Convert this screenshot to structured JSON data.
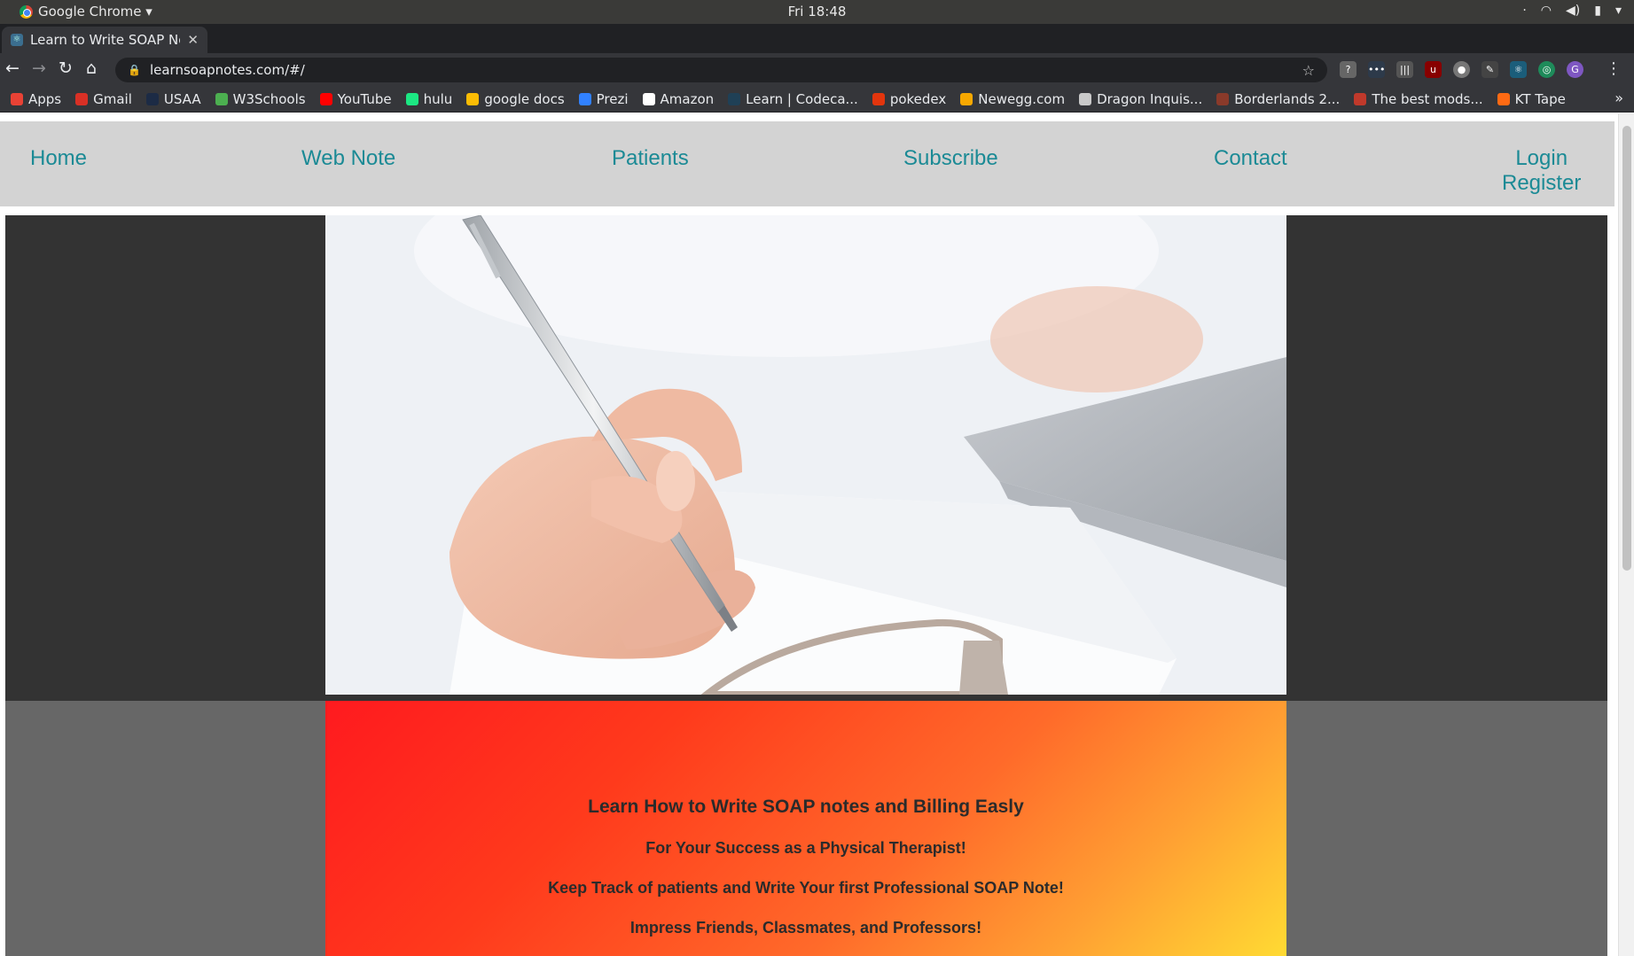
{
  "os": {
    "app_name": "Google Chrome ▾",
    "clock": "Fri 18:48"
  },
  "browser": {
    "tab_title": "Learn to Write SOAP Note",
    "url": "learnsoapnotes.com/#/",
    "bookmarks": [
      {
        "label": "Apps",
        "color": "#e94235"
      },
      {
        "label": "Gmail",
        "color": "#d93025"
      },
      {
        "label": "USAA",
        "color": "#1c2b45"
      },
      {
        "label": "W3Schools",
        "color": "#4caf50"
      },
      {
        "label": "YouTube",
        "color": "#ff0000"
      },
      {
        "label": "hulu",
        "color": "#1ce783"
      },
      {
        "label": "google docs",
        "color": "#fbbc04"
      },
      {
        "label": "Prezi",
        "color": "#3181ff"
      },
      {
        "label": "Amazon",
        "color": "#ffffff"
      },
      {
        "label": "Learn | Codeca...",
        "color": "#1f4056"
      },
      {
        "label": "pokedex",
        "color": "#e3350d"
      },
      {
        "label": "Newegg.com",
        "color": "#f7a800"
      },
      {
        "label": "Dragon Inquis...",
        "color": "#c9c9c9"
      },
      {
        "label": "Borderlands 2...",
        "color": "#8a3a2a"
      },
      {
        "label": "The best mods...",
        "color": "#c0392b"
      },
      {
        "label": "KT Tape",
        "color": "#ff6a13"
      }
    ]
  },
  "site": {
    "nav": {
      "home": "Home",
      "web_note": "Web Note",
      "patients": "Patients",
      "subscribe": "Subscribe",
      "contact": "Contact",
      "login": "Login",
      "register": "Register"
    },
    "promo": {
      "heading": "Learn How to Write SOAP notes and Billing Easly",
      "line1": "For Your Success as a Physical Therapist!",
      "line2": "Keep Track of patients and Write Your first Professional SOAP Note!",
      "line3": "Impress Friends, Classmates, and Professors!"
    }
  }
}
